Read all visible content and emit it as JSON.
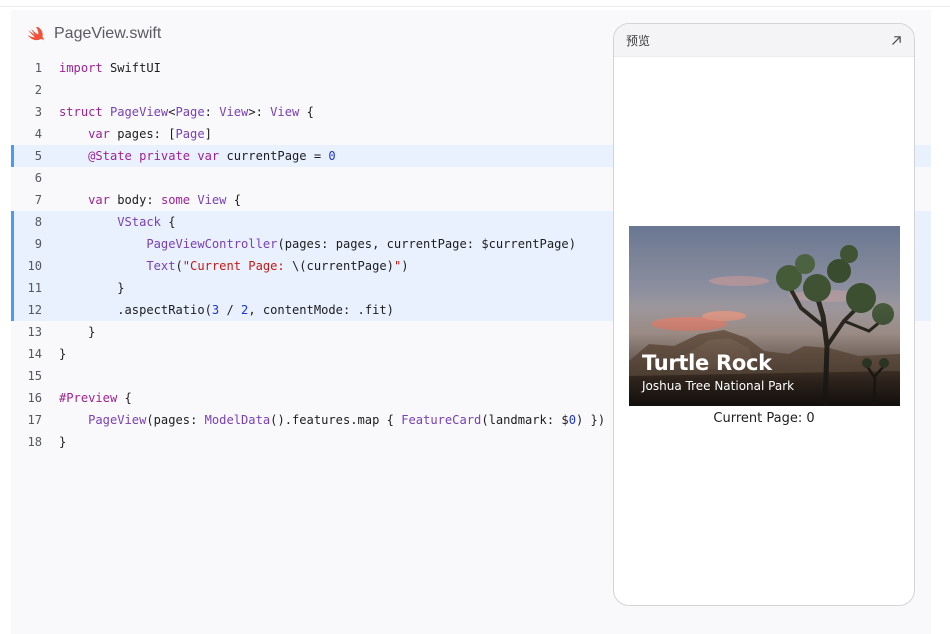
{
  "file": {
    "icon": "swift-icon",
    "name": "PageView.swift"
  },
  "code": {
    "highlighted_lines": [
      5,
      8,
      9,
      10,
      11,
      12
    ],
    "lines": [
      {
        "n": "1",
        "text": "import SwiftUI"
      },
      {
        "n": "2",
        "text": ""
      },
      {
        "n": "3",
        "text": "struct PageView<Page: View>: View {"
      },
      {
        "n": "4",
        "text": "    var pages: [Page]"
      },
      {
        "n": "5",
        "text": "    @State private var currentPage = 0"
      },
      {
        "n": "6",
        "text": ""
      },
      {
        "n": "7",
        "text": "    var body: some View {"
      },
      {
        "n": "8",
        "text": "        VStack {"
      },
      {
        "n": "9",
        "text": "            PageViewController(pages: pages, currentPage: $currentPage)"
      },
      {
        "n": "10",
        "text": "            Text(\"Current Page: \\(currentPage)\")"
      },
      {
        "n": "11",
        "text": "        }"
      },
      {
        "n": "12",
        "text": "        .aspectRatio(3 / 2, contentMode: .fit)"
      },
      {
        "n": "13",
        "text": "    }"
      },
      {
        "n": "14",
        "text": "}"
      },
      {
        "n": "15",
        "text": ""
      },
      {
        "n": "16",
        "text": "#Preview {"
      },
      {
        "n": "17",
        "text": "    PageView(pages: ModelData().features.map { FeatureCard(landmark: $0) })"
      },
      {
        "n": "18",
        "text": "}"
      }
    ]
  },
  "preview": {
    "title": "预览",
    "expand_icon": "expand-arrow-icon",
    "card": {
      "title": "Turtle Rock",
      "subtitle": "Joshua Tree National Park"
    },
    "current_page_label": "Current Page: 0"
  },
  "colors": {
    "keyword": "#9b2393",
    "type": "#7840b4",
    "number": "#1c35d1",
    "string": "#c41a16",
    "highlight_bg": "#e9f1ff",
    "highlight_bar": "#4c9bf0",
    "swift_orange": "#f05138"
  }
}
